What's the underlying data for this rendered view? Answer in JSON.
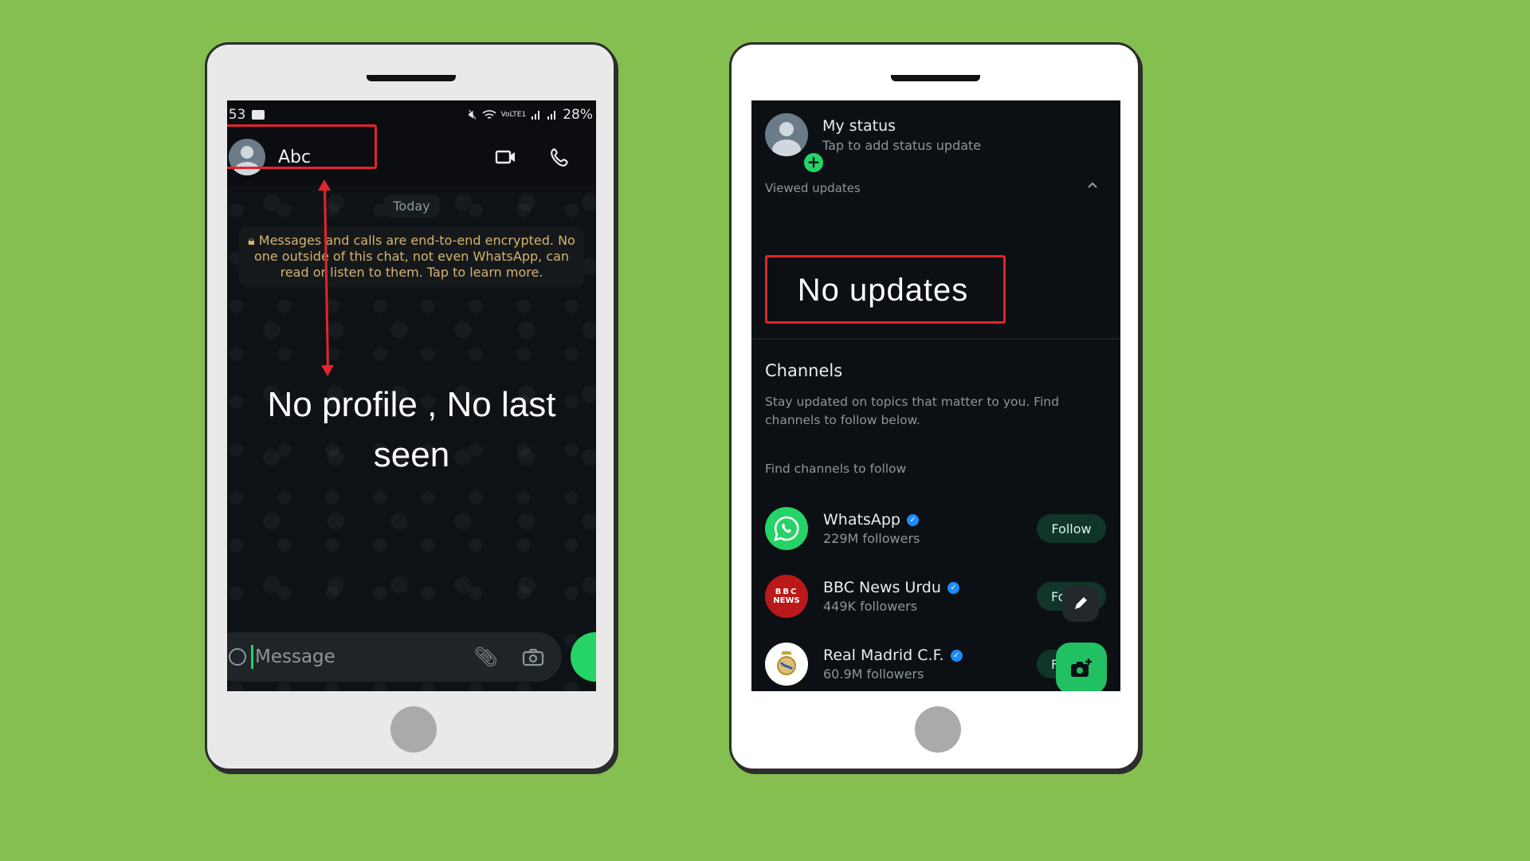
{
  "left_phone": {
    "statusbar": {
      "time": ":53",
      "battery": "28%",
      "network": "VoLTE1"
    },
    "chat_header": {
      "contact_name": "Abc"
    },
    "date_chip": "Today",
    "encryption_notice": "Messages and calls are end-to-end encrypted. No one outside of this chat, not even WhatsApp, can read or listen to them. Tap to learn more.",
    "annotation": "No profile , No last seen",
    "composer": {
      "placeholder": "Message"
    }
  },
  "right_phone": {
    "my_status": {
      "title": "My status",
      "subtitle": "Tap to add status update"
    },
    "viewed_updates_label": "Viewed updates",
    "annotation": "No  updates",
    "channels": {
      "title": "Channels",
      "description": "Stay updated on topics that matter to you. Find channels to follow below.",
      "find_label": "Find channels to follow",
      "items": [
        {
          "name": "WhatsApp",
          "followers": "229M followers",
          "button": "Follow",
          "logo_color": "#25d366",
          "verified": true
        },
        {
          "name": "BBC News Urdu",
          "followers": "449K followers",
          "button": "Follow",
          "logo_color": "#bb1919",
          "verified": true
        },
        {
          "name": "Real Madrid C.F.",
          "followers": "60.9M followers",
          "button": "Follow",
          "logo_color": "#ffffff",
          "verified": true
        }
      ]
    },
    "bbc_logo_top": "BBC",
    "bbc_logo_bottom": "NEWS"
  },
  "colors": {
    "background": "#84bf4f",
    "annotation_red": "#e3242b",
    "whatsapp_green": "#25d366"
  }
}
